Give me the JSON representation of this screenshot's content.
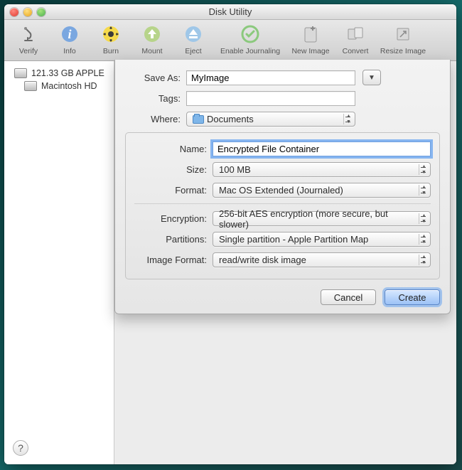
{
  "window_title": "Disk Utility",
  "toolbar": {
    "verify": "Verify",
    "info": "Info",
    "burn": "Burn",
    "mount": "Mount",
    "eject": "Eject",
    "journal": "Enable Journaling",
    "newimage": "New Image",
    "convert": "Convert",
    "resize": "Resize Image"
  },
  "sidebar": {
    "disk": "121.33 GB APPLE",
    "volume": "Macintosh HD"
  },
  "sheet": {
    "save_as_label": "Save As:",
    "save_as_value": "MyImage",
    "tags_label": "Tags:",
    "tags_value": "",
    "where_label": "Where:",
    "where_value": "Documents",
    "name_label": "Name:",
    "name_value": "Encrypted File Container",
    "size_label": "Size:",
    "size_value": "100 MB",
    "format_label": "Format:",
    "format_value": "Mac OS Extended (Journaled)",
    "encryption_label": "Encryption:",
    "encryption_value": "256-bit AES encryption (more secure, but slower)",
    "partitions_label": "Partitions:",
    "partitions_value": "Single partition - Apple Partition Map",
    "image_format_label": "Image Format:",
    "image_format_value": "read/write disk image",
    "cancel": "Cancel",
    "create": "Create"
  }
}
